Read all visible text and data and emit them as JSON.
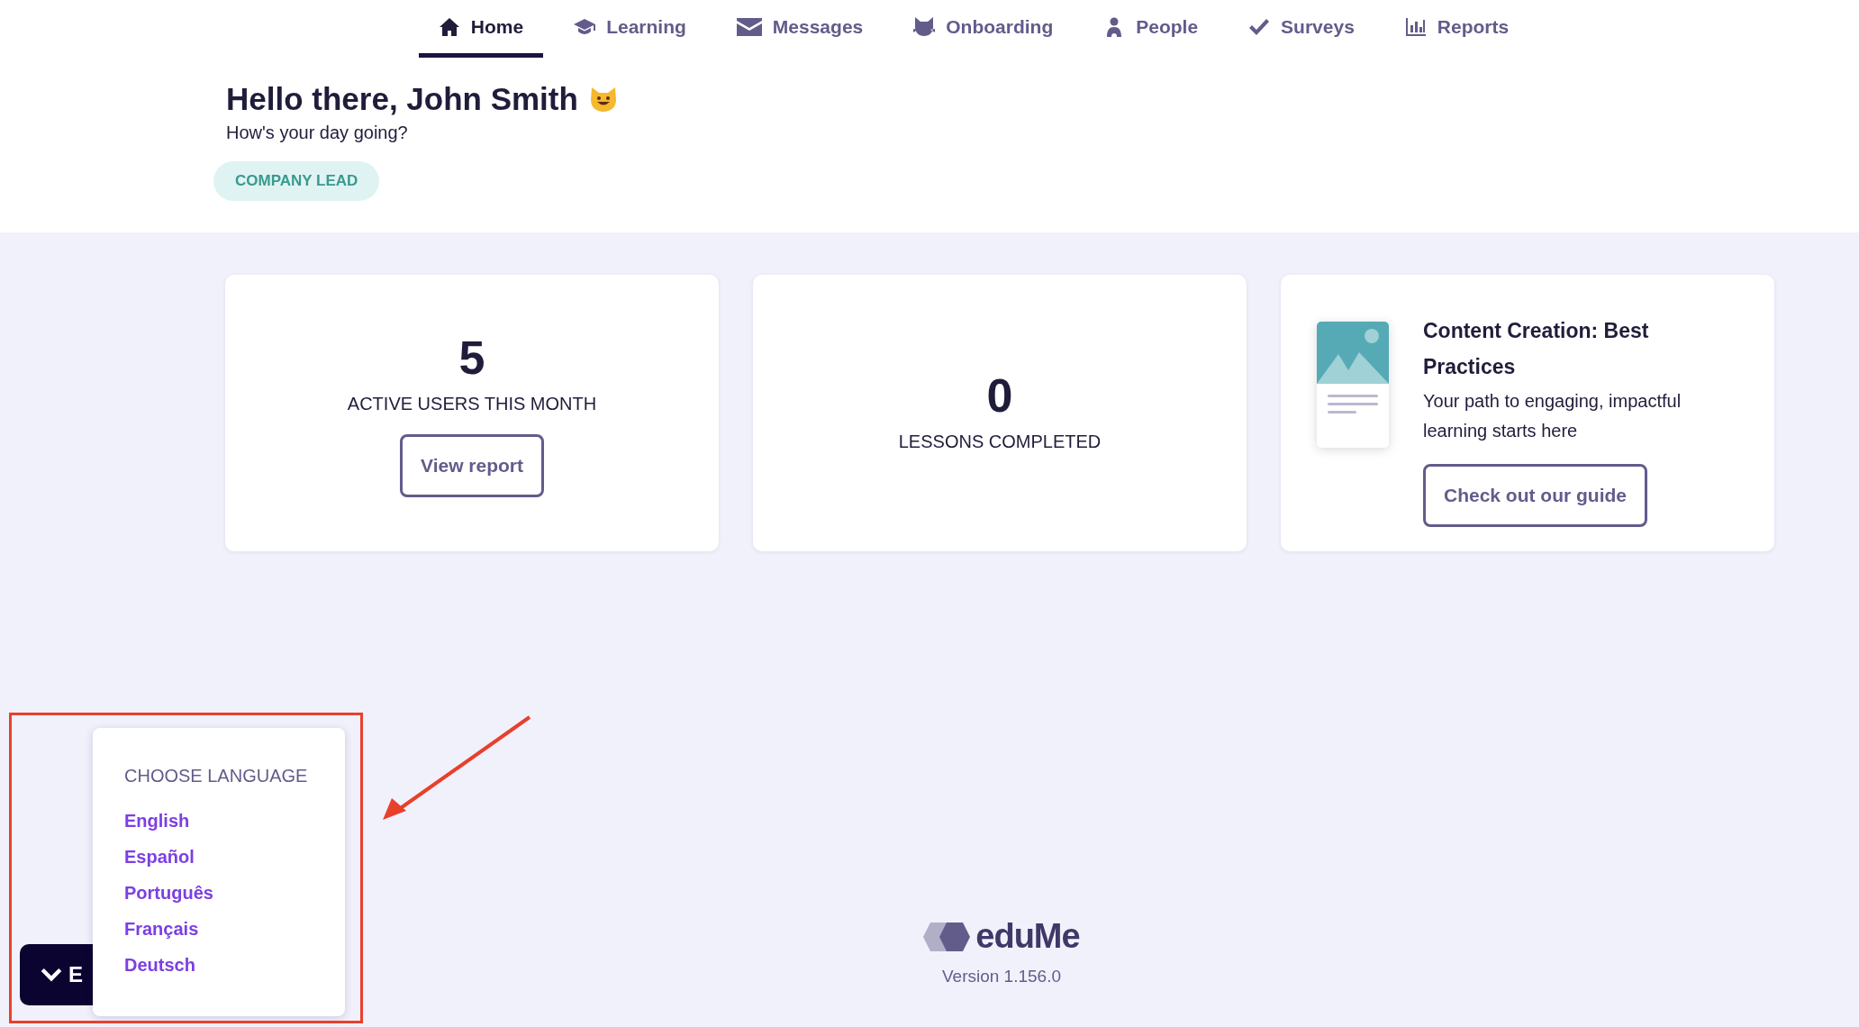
{
  "nav": [
    {
      "label": "Home",
      "selected": true
    },
    {
      "label": "Learning",
      "selected": false
    },
    {
      "label": "Messages",
      "selected": false
    },
    {
      "label": "Onboarding",
      "selected": false
    },
    {
      "label": "People",
      "selected": false
    },
    {
      "label": "Surveys",
      "selected": false
    },
    {
      "label": "Reports",
      "selected": false
    }
  ],
  "greeting": {
    "title": "Hello there, John Smith",
    "subtitle": "How's your day going?",
    "badge": "COMPANY LEAD"
  },
  "stats": [
    {
      "value": "5",
      "label": "ACTIVE USERS THIS MONTH",
      "button": "View report"
    },
    {
      "value": "0",
      "label": "LESSONS COMPLETED"
    }
  ],
  "guide": {
    "title": "Content Creation: Best Practices",
    "text": "Your path to engaging, impactful learning starts here",
    "button": "Check out our guide"
  },
  "language_button": {
    "label": "E"
  },
  "language_menu": {
    "title": "CHOOSE LANGUAGE",
    "options": [
      "English",
      "Español",
      "Português",
      "Français",
      "Deutsch"
    ]
  },
  "footer": {
    "logo": "eduMe",
    "version": "Version 1.156.0"
  }
}
